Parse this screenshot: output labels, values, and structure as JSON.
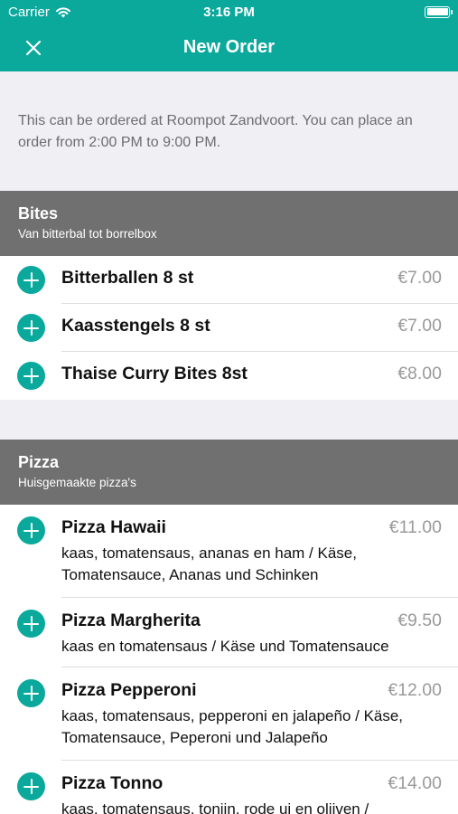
{
  "status_bar": {
    "carrier": "Carrier",
    "time": "3:16 PM"
  },
  "nav": {
    "title": "New Order"
  },
  "info": {
    "text": "This can be ordered at Roompot Zandvoort. You can place an order from 2:00 PM to 9:00 PM."
  },
  "sections": [
    {
      "title": "Bites",
      "subtitle": "Van bitterbal tot borrelbox",
      "items": [
        {
          "name": "Bitterballen 8 st",
          "price": "€7.00"
        },
        {
          "name": "Kaasstengels 8 st",
          "price": "€7.00"
        },
        {
          "name": "Thaise Curry Bites 8st",
          "price": "€8.00"
        }
      ]
    },
    {
      "title": "Pizza",
      "subtitle": "Huisgemaakte pizza's",
      "items": [
        {
          "name": "Pizza Hawaii",
          "price": "€11.00",
          "description": "kaas, tomatensaus, ananas en ham  / Käse, Tomatensauce, Ananas und Schinken"
        },
        {
          "name": "Pizza Margherita",
          "price": "€9.50",
          "description": "kaas en tomatensaus  / Käse und Tomatensauce"
        },
        {
          "name": "Pizza Pepperoni",
          "price": "€12.00",
          "description": "kaas, tomatensaus, pepperoni en jalapeño / Käse, Tomatensauce, Peperoni und Jalapeño"
        },
        {
          "name": "Pizza Tonno",
          "price": "€14.00",
          "description": "kaas, tomatensaus, tonijn, rode ui en olijven  /"
        }
      ]
    }
  ],
  "colors": {
    "accent": "#0aa99c",
    "section_header": "#707070",
    "background": "#efeff4"
  }
}
